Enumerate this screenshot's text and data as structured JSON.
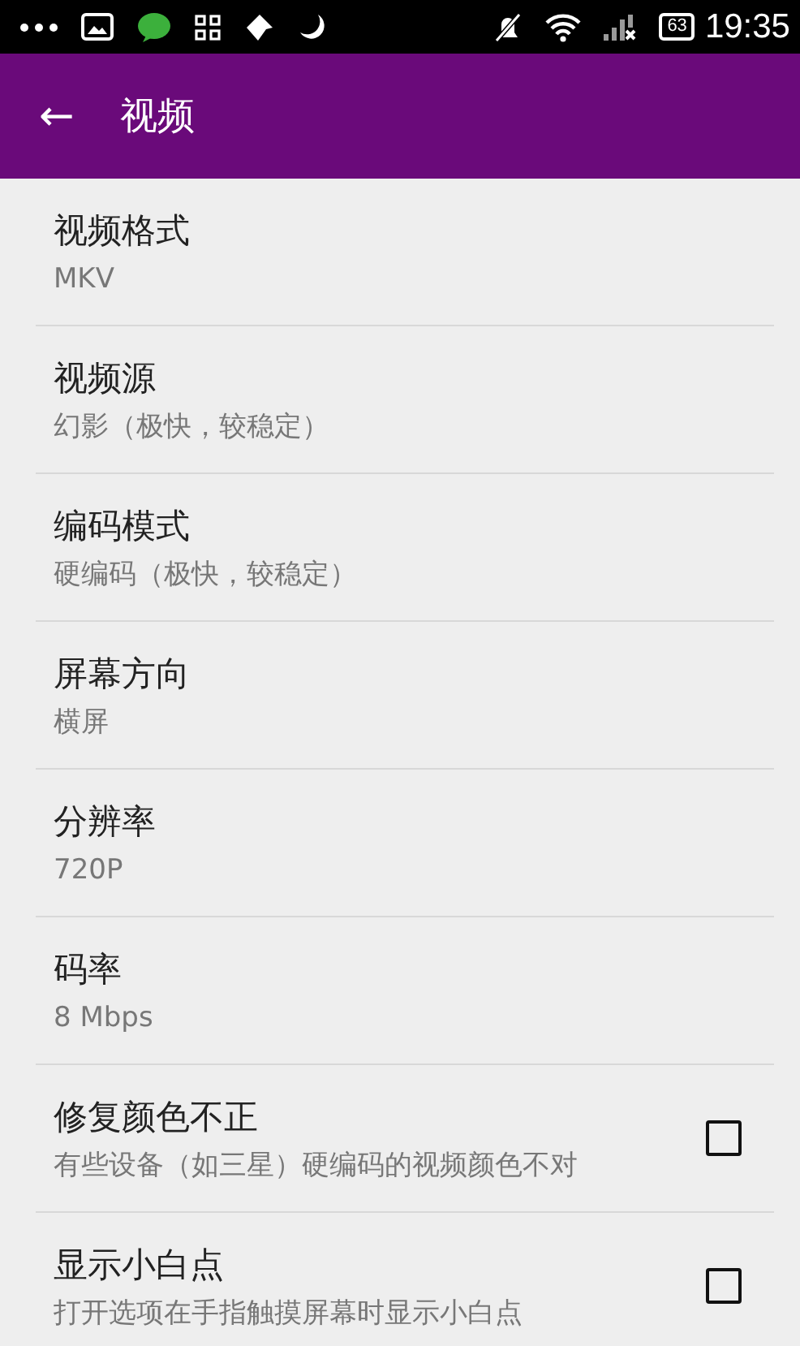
{
  "status_bar": {
    "battery": "63",
    "time": "19:35"
  },
  "app_bar": {
    "back": "←",
    "title": "视频"
  },
  "settings": [
    {
      "kind": "value",
      "title": "视频格式",
      "summary": "MKV"
    },
    {
      "kind": "value",
      "title": "视频源",
      "summary": "幻影（极快，较稳定）"
    },
    {
      "kind": "value",
      "title": "编码模式",
      "summary": "硬编码（极快，较稳定）"
    },
    {
      "kind": "value",
      "title": "屏幕方向",
      "summary": "横屏"
    },
    {
      "kind": "value",
      "title": "分辨率",
      "summary": "720P"
    },
    {
      "kind": "value",
      "title": "码率",
      "summary": "8 Mbps"
    },
    {
      "kind": "checkbox",
      "title": "修复颜色不正",
      "summary": "有些设备（如三星）硬编码的视频颜色不对",
      "checked": false
    },
    {
      "kind": "checkbox",
      "title": "显示小白点",
      "summary": "打开选项在手指触摸屏幕时显示小白点",
      "checked": false
    }
  ]
}
